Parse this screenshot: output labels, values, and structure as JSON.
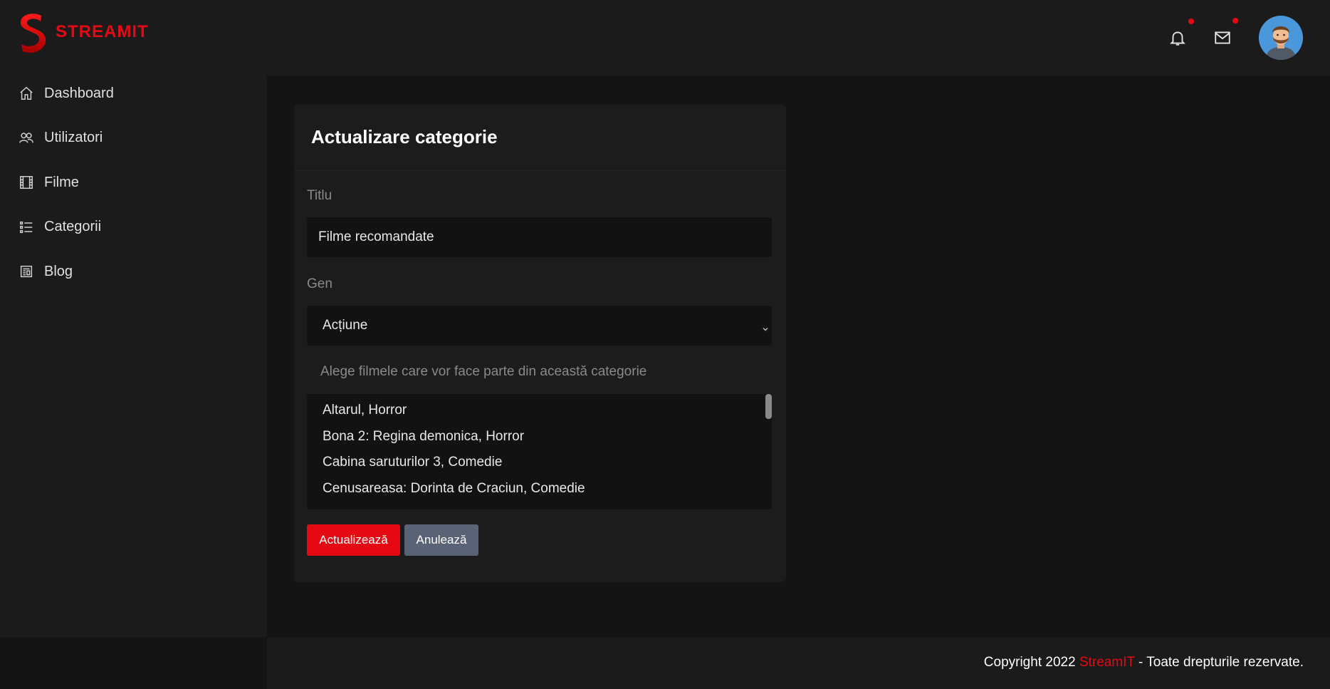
{
  "brand": {
    "name": "STREAMIT",
    "color": "#e50914"
  },
  "sidebar": {
    "items": [
      {
        "label": "Dashboard",
        "icon": "home-icon"
      },
      {
        "label": "Utilizatori",
        "icon": "users-icon"
      },
      {
        "label": "Filme",
        "icon": "film-icon"
      },
      {
        "label": "Categorii",
        "icon": "list-icon"
      },
      {
        "label": "Blog",
        "icon": "newspaper-icon"
      }
    ]
  },
  "header": {
    "icons": [
      "bell-icon",
      "mail-icon"
    ],
    "avatar": "user-avatar"
  },
  "form": {
    "title": "Actualizare categorie",
    "title_label": "Titlu",
    "title_value": "Filme recomandate",
    "genre_label": "Gen",
    "genre_value": "Acțiune",
    "movies_hint": "Alege filmele care vor face parte din această categorie",
    "movies": [
      "Altarul,  Horror",
      "Bona 2: Regina demonica,  Horror",
      "Cabina saruturilor 3,  Comedie",
      "Cenusareasa: Dorinta de Craciun,  Comedie"
    ],
    "submit_label": "Actualizează",
    "cancel_label": "Anulează"
  },
  "footer": {
    "prefix": "Copyright 2022 ",
    "brand": "StreamIT",
    "suffix": " - Toate drepturile rezervate."
  }
}
